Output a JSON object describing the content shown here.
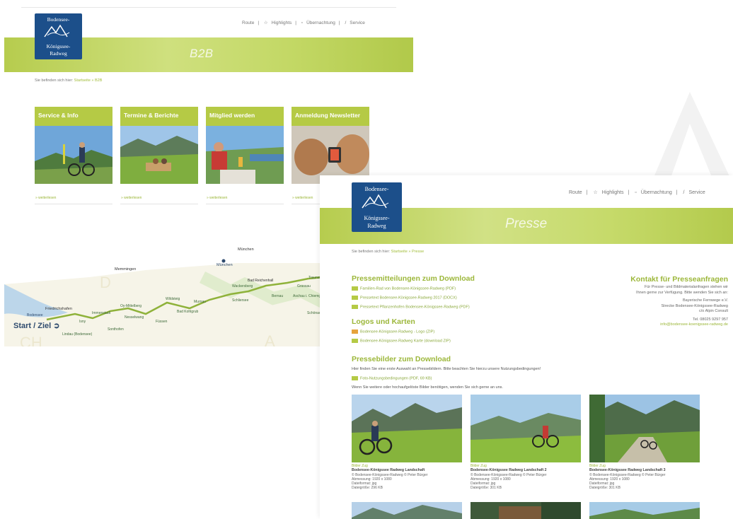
{
  "logo": {
    "line1": "Bodensee-",
    "line2": "Königssee-",
    "line3": "Radweg"
  },
  "b2b": {
    "nav": [
      "Route",
      "Highlights",
      "Übernachtung",
      "Service"
    ],
    "band_title": "B2B",
    "breadcrumb": {
      "prefix": "Sie befinden sich hier:",
      "current": "Startseite » B2B"
    },
    "cards": [
      {
        "title": "Service & Info",
        "link": "» weiterlesen"
      },
      {
        "title": "Termine & Berichte",
        "link": "» weiterlesen"
      },
      {
        "title": "Mitglied werden",
        "link": "» weiterlesen"
      },
      {
        "title": "Anmeldung Newsletter",
        "link": "» weiterlesen"
      }
    ],
    "map": {
      "start_ziel": "Start / Ziel",
      "cities": [
        "München",
        "München",
        "Memmingen",
        "Friedrichshafen",
        "Bad Reichenhall"
      ],
      "towns": [
        "Bodensee",
        "Lindau (Bodensee)",
        "Isny",
        "Immenstadt",
        "Sonthofen",
        "Oy-Mittelberg",
        "Nesselwang",
        "Füssen",
        "Wildsteig",
        "Murnau",
        "Bad Kohlgrub",
        "Schliersee",
        "Wackersberg",
        "Bernau",
        "Grassau",
        "Aschau i. Chiemgau",
        "Traunstein",
        "Schönau"
      ],
      "region_letters": [
        "D",
        "CH",
        "A"
      ]
    }
  },
  "presse": {
    "nav": [
      "Route",
      "Highlights",
      "Übernachtung",
      "Service"
    ],
    "band_title": "Presse",
    "breadcrumb": {
      "prefix": "Sie befinden sich hier:",
      "current": "Startseite » Presse"
    },
    "pressemitteilungen": {
      "title": "Pressemitteilungen zum Download",
      "items": [
        "Familien-Rad von Bodensee-Königssee-Radweg (PDF)",
        "Pressetext Bodensee-Königssee-Radweg 2017 (DOCX)",
        "Pressetext Pflanzenhofen Bodensee-Königssee-Radweg (PDF)"
      ]
    },
    "logos": {
      "title": "Logos und Karten",
      "items": [
        "Bodensee-Königssee-Radweg - Logo (ZIP)",
        "Bodensee-Königssee-Radweg Karte (download ZIP)"
      ]
    },
    "kontakt": {
      "title": "Kontakt für Presseanfragen",
      "lines": [
        "Für Presse- und Bildmaterialanfragen stehen wir",
        "Ihnen gerne zur Verfügung. Bitte wenden Sie sich an:",
        "",
        "Bayerische Fernwege e.V.",
        "Strecke Bodensee-Königssee-Radweg",
        "c/o Alpin Consult",
        "",
        "Tel. 08025 9297 957"
      ],
      "email": "info@bodensee-koenigssee-radweg.de"
    },
    "pressebilder": {
      "title": "Pressebilder zum Download",
      "intro": "Hier finden Sie eine erste Auswahl an Pressebildern. Bitte beachten Sie hierzu unsere Nutzungsbedingungen!",
      "link": "Foto-Nutzungsbedingungen (PDF, 69 KB)",
      "note": "Wenn Sie weitere oder hochaufgelöste Bilder benötigen, wenden Sie sich gerne an uns.",
      "photos": [
        {
          "category": "Bilder Zug",
          "title": "Bodensee-Königssee Radweg Landschaft",
          "credit": "© Bodensee-Königssee-Radweg © Peter Bürger",
          "size": "Abmessung: 1920 x 1080",
          "format": "Dateiformat: jpg",
          "filesize": "Dateigröße: 296 KB"
        },
        {
          "category": "Bilder Zug",
          "title": "Bodensee-Königssee Radweg Landschaft 2",
          "credit": "© Bodensee-Königssee-Radweg © Peter Bürger",
          "size": "Abmessung: 1920 x 1080",
          "format": "Dateiformat: jpg",
          "filesize": "Dateigröße: 301 KB"
        },
        {
          "category": "Bilder Zug",
          "title": "Bodensee-Königssee Radweg Landschaft 3",
          "credit": "© Bodensee-Königssee-Radweg © Peter Bürger",
          "size": "Abmessung: 1920 x 1080",
          "format": "Dateiformat: jpg",
          "filesize": "Dateigröße: 301 KB"
        }
      ]
    }
  },
  "colors": {
    "green": "#b5ca45",
    "green_text": "#9cb73a",
    "logo_blue": "#1c4f8a"
  }
}
